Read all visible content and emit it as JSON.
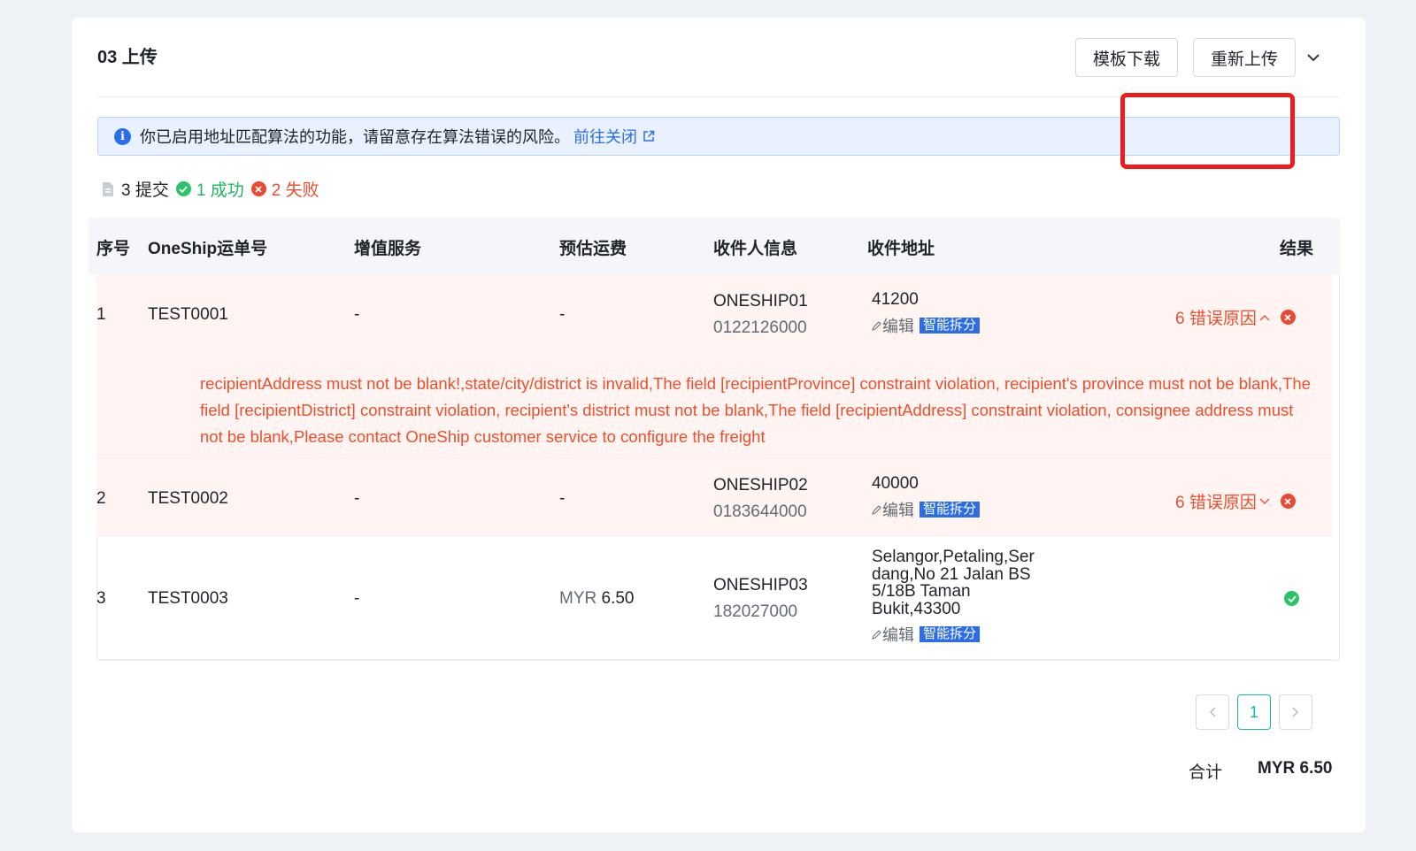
{
  "section": {
    "title": "03 上传"
  },
  "toolbar": {
    "template_download": "模板下载",
    "reupload": "重新上传"
  },
  "alert": {
    "message": "你已启用地址匹配算法的功能，请留意存在算法错误的风险。",
    "link": "前往关闭"
  },
  "stats": {
    "submitted": "3 提交",
    "success": "1 成功",
    "failed": "2 失败"
  },
  "table": {
    "headers": [
      "序号",
      "OneShip运单号",
      "增值服务",
      "预估运费",
      "收件人信息",
      "收件地址",
      "结果"
    ],
    "edit_label": "编辑",
    "smart_label": "智能拆分",
    "rows": [
      {
        "index": "1",
        "waybill": "TEST0001",
        "vas": "-",
        "fee": "-",
        "recipient_name": "ONESHIP01",
        "recipient_phone": "0122126000",
        "address": "41200",
        "result": "6 错误原因",
        "status": "failed",
        "expanded": true,
        "error_detail": "recipientAddress must not be blank!,state/city/district is invalid,The field [recipientProvince] constraint violation, recipient's province must not be blank,The field [recipientDistrict] constraint violation, recipient's district must not be blank,The field [recipientAddress] constraint violation, consignee address must not be blank,Please contact OneShip customer service to configure the freight"
      },
      {
        "index": "2",
        "waybill": "TEST0002",
        "vas": "-",
        "fee": "-",
        "recipient_name": "ONESHIP02",
        "recipient_phone": "0183644000",
        "address": "40000",
        "result": "6 错误原因",
        "status": "failed",
        "expanded": false
      },
      {
        "index": "3",
        "waybill": "TEST0003",
        "vas": "-",
        "fee_currency": "MYR",
        "fee_amount": "6.50",
        "recipient_name": "ONESHIP03",
        "recipient_phone": "182027000",
        "address_lines": [
          "Selangor,Petaling,Ser",
          "dang,No 21 Jalan BS",
          "5/18B Taman",
          "Bukit,43300"
        ],
        "status": "success"
      }
    ]
  },
  "pagination": {
    "current": "1"
  },
  "summary": {
    "total_label": "合计",
    "total_value": "MYR 6.50"
  }
}
